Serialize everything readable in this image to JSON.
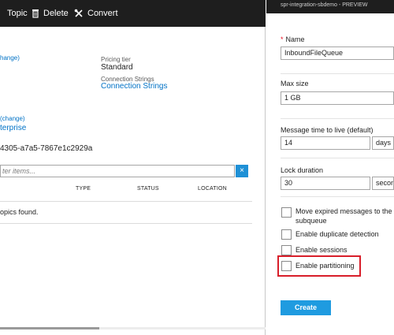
{
  "toolbar": {
    "topic_label": "Topic",
    "delete_label": "Delete",
    "convert_label": "Convert"
  },
  "namespace": {
    "change_link_1": "hange)",
    "pricing_tier_label": "Pricing tier",
    "pricing_tier_value": "Standard",
    "connection_strings_label": "Connection Strings",
    "connection_strings_link": "Connection Strings",
    "change_link_2": "(change)",
    "tier_link": "terprise",
    "guid": "4305-a7a5-7867e1c2929a"
  },
  "filter": {
    "placeholder": "ter items...",
    "clear_label": "×"
  },
  "table": {
    "columns": [
      "TYPE",
      "STATUS",
      "LOCATION"
    ],
    "empty_message": "opics found."
  },
  "blade": {
    "subtitle": "spr-integration-sbdemo - PREVIEW",
    "required_marker": "*",
    "name_label": "Name",
    "name_value": "InboundFileQueue",
    "max_size_label": "Max size",
    "max_size_value": "1 GB",
    "ttl_label": "Message time to live (default)",
    "ttl_value": "14",
    "ttl_unit": "days",
    "lock_label": "Lock duration",
    "lock_value": "30",
    "lock_unit": "secon",
    "checkboxes": [
      {
        "line1": "Move expired messages to the de",
        "line2": "subqueue"
      },
      {
        "line1": "Enable duplicate detection"
      },
      {
        "line1": "Enable sessions"
      },
      {
        "line1": "Enable partitioning"
      }
    ],
    "create_label": "Create"
  },
  "colors": {
    "accent": "#1f9be0",
    "highlight": "#d81e2a",
    "toolbar_bg": "#1e1e1e",
    "link": "#0072c6"
  }
}
